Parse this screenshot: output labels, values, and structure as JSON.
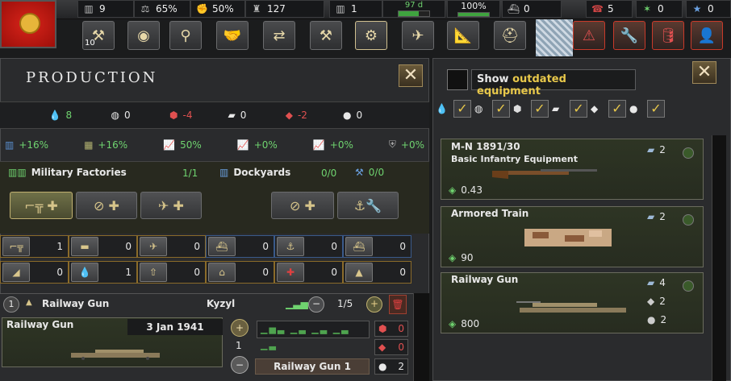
{
  "topbar": {
    "resources": [
      {
        "icon": "factory-icon",
        "value": "9"
      },
      {
        "icon": "scales-icon",
        "value": "65%"
      },
      {
        "icon": "manpower-icon",
        "value": "50%"
      },
      {
        "icon": "army-icon",
        "value": "127"
      },
      {
        "icon": "factory-icon",
        "value": "1"
      },
      {
        "icon": "fuel-icon",
        "value": "97 d",
        "bar": 0.65
      },
      {
        "icon": "supply-icon",
        "value": "100%"
      },
      {
        "icon": "convoy-icon",
        "value": "0"
      },
      {
        "icon": "phone-icon",
        "value": "5"
      },
      {
        "icon": "star-green-icon",
        "value": "0"
      },
      {
        "icon": "star-blue-icon",
        "value": "0"
      }
    ],
    "counter": "10"
  },
  "production": {
    "title": "Production",
    "resources": [
      {
        "icon": "oil-icon",
        "value": "8",
        "color": "#6fd36f"
      },
      {
        "icon": "rubber-icon",
        "value": "0",
        "color": "#e8e8e8"
      },
      {
        "icon": "aluminium-icon",
        "value": "-4",
        "color": "#e05050"
      },
      {
        "icon": "steel-icon",
        "value": "0",
        "color": "#e8e8e8"
      },
      {
        "icon": "tungsten-icon",
        "value": "-2",
        "color": "#e05050"
      },
      {
        "icon": "chromium-icon",
        "value": "0",
        "color": "#e8e8e8"
      }
    ],
    "modifiers": [
      "+16%",
      "+16%",
      "50%",
      "+0%",
      "+0%",
      "+0%"
    ],
    "military_label": "Military Factories",
    "military_count": "1/1",
    "dockyards_label": "Dockyards",
    "dockyards_count": "0/0",
    "dockyards_count2": "0/0",
    "stock_row1": [
      "1",
      "0",
      "0",
      "0",
      "0",
      "0"
    ],
    "stock_row2": [
      "0",
      "1",
      "0",
      "0",
      "0",
      "0"
    ],
    "line": {
      "number": "1",
      "name": "Railway Gun",
      "location": "Kyzyl",
      "factories": "1/5",
      "item_label": "Railway Gun",
      "date": "3 Jan 1941",
      "amount": "1",
      "variant": "Railway Gun 1",
      "cost1": "0",
      "cost2": "0",
      "cost3": "2"
    }
  },
  "equipment": {
    "show_label": "Show",
    "outdated_label": "outdated equipment",
    "cards": [
      {
        "name": "M-N 1891/30",
        "sub": "Basic Infantry Equipment",
        "cost": "0.43",
        "res": [
          {
            "icon": "steel-icon",
            "value": "2"
          }
        ]
      },
      {
        "name": "Armored Train",
        "sub": "",
        "cost": "90",
        "res": [
          {
            "icon": "steel-icon",
            "value": "2"
          }
        ]
      },
      {
        "name": "Railway Gun",
        "sub": "",
        "cost": "800",
        "res": [
          {
            "icon": "steel-icon",
            "value": "4"
          },
          {
            "icon": "tungsten-icon",
            "value": "2"
          },
          {
            "icon": "chromium-icon",
            "value": "2"
          }
        ]
      }
    ]
  }
}
